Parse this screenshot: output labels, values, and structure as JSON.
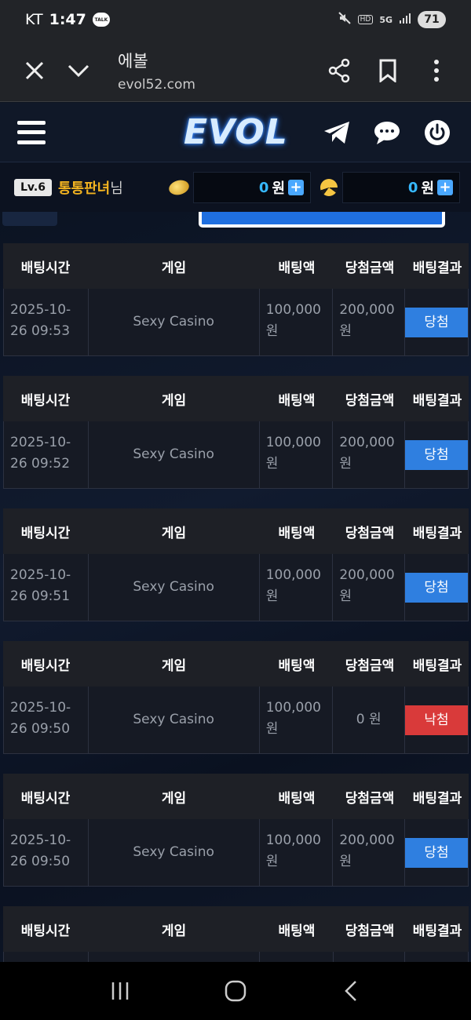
{
  "status_bar": {
    "carrier": "KT",
    "time": "1:47",
    "talk_badge": "TALK",
    "hd": "HD",
    "network": "5G",
    "battery": "71"
  },
  "browser": {
    "title": "에볼",
    "domain": "evol52.com"
  },
  "site": {
    "logo": "EVOL"
  },
  "user": {
    "level": "Lv.6",
    "name": "통통판녀",
    "suffix": "님",
    "cash_amount": "0",
    "cash_unit": "원",
    "point_amount": "0",
    "point_unit": "원",
    "plus": "+"
  },
  "table_headers": {
    "time": "배팅시간",
    "game": "게임",
    "bet": "배팅액",
    "win": "당첨금액",
    "result": "배팅결과"
  },
  "bets": [
    {
      "date": "2025-10-",
      "time": "26 09:53",
      "game": "Sexy Casino",
      "bet_a": "100,000",
      "bet_b": "원",
      "win_a": "200,000",
      "win_b": "원",
      "result": "당첨",
      "status": "win"
    },
    {
      "date": "2025-10-",
      "time": "26 09:52",
      "game": "Sexy Casino",
      "bet_a": "100,000",
      "bet_b": "원",
      "win_a": "200,000",
      "win_b": "원",
      "result": "당첨",
      "status": "win"
    },
    {
      "date": "2025-10-",
      "time": "26 09:51",
      "game": "Sexy Casino",
      "bet_a": "100,000",
      "bet_b": "원",
      "win_a": "200,000",
      "win_b": "원",
      "result": "당첨",
      "status": "win"
    },
    {
      "date": "2025-10-",
      "time": "26 09:50",
      "game": "Sexy Casino",
      "bet_a": "100,000",
      "bet_b": "원",
      "win_a": "0 원",
      "win_b": "",
      "result": "낙첨",
      "status": "lose"
    },
    {
      "date": "2025-10-",
      "time": "26 09:50",
      "game": "Sexy Casino",
      "bet_a": "100,000",
      "bet_b": "원",
      "win_a": "200,000",
      "win_b": "원",
      "result": "당첨",
      "status": "win"
    }
  ],
  "colors": {
    "win": "#2f7fe0",
    "lose": "#d93a3a",
    "username": "#f2b320",
    "balance": "#36b8ff"
  }
}
